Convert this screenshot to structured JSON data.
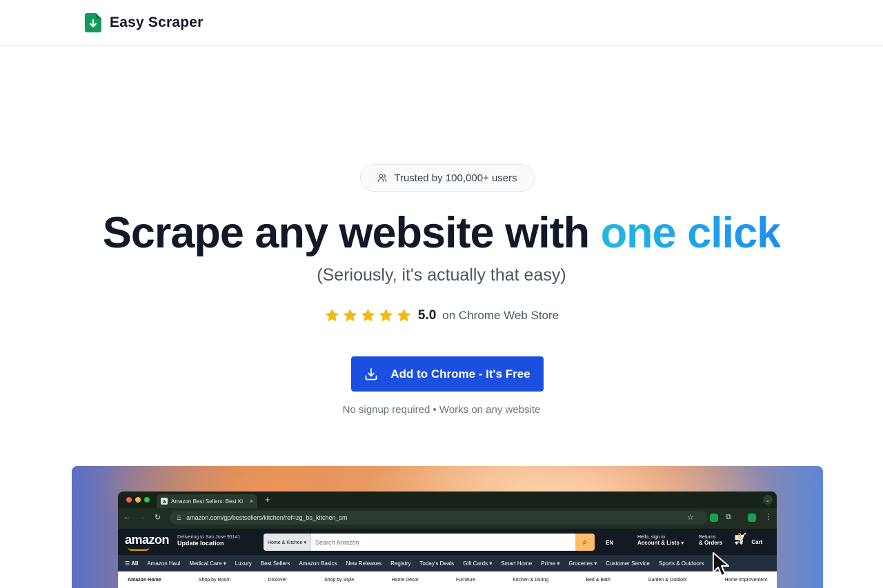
{
  "header": {
    "brand_name": "Easy Scraper"
  },
  "hero": {
    "trust_badge": "Trusted by 100,000+ users",
    "title_main": "Scrape any website with ",
    "title_accent": "one click",
    "subtitle": "(Seriously, it's actually that easy)",
    "rating_score": "5.0",
    "rating_suffix": "on Chrome Web Store",
    "rating_stars": 5,
    "cta_label": "Add to Chrome - It's Free",
    "cta_note": "No signup required • Works on any website"
  },
  "colors": {
    "accent": "#1d8ff2",
    "cta": "#1a4fe0",
    "star": "#f5b90f",
    "brand_green": "#159a5b"
  },
  "showcase": {
    "tab_title": "Amazon Best Sellers: Best Ki",
    "tab_favicon": "a",
    "url": "amazon.com/gp/bestsellers/kitchen/ref=zg_bs_kitchen_sm",
    "amazon": {
      "logo": "amazon",
      "deliver_line1": "Delivering to San Jose 95141",
      "deliver_line2": "Update location",
      "search_department": "Home & Kitchen ▾",
      "search_placeholder": "Search Amazon",
      "language": "EN",
      "account_line1": "Hello, sign in",
      "account_line2": "Account & Lists ▾",
      "orders_line1": "Returns",
      "orders_line2": "& Orders",
      "cart_count": "0",
      "cart_label": "Cart",
      "nav_items": [
        "All",
        "Amazon Haul",
        "Medical Care ▾",
        "Luxury",
        "Best Sellers",
        "Amazon Basics",
        "New Releases",
        "Registry",
        "Today's Deals",
        "Gift Cards ▾",
        "Smart Home",
        "Prime ▾",
        "Groceries ▾",
        "Customer Service",
        "Sports & Outdoors"
      ],
      "sub_nav_items": [
        "Amazon Home",
        "Shop by Room",
        "Discover",
        "Shop by Style",
        "Home Décor",
        "Furniture",
        "Kitchen & Dining",
        "Bed & Bath",
        "Garden & Outdoor",
        "Home Improvement"
      ]
    }
  }
}
